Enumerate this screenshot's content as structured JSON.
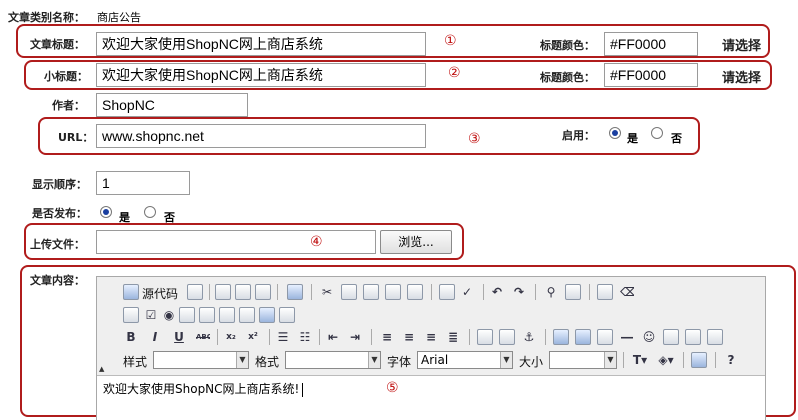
{
  "category": {
    "label": "文章类别名称：",
    "value": "商店公告"
  },
  "title_row": {
    "label": "文章标题：",
    "value": "欢迎大家使用ShopNC网上商店系统",
    "color_label": "标题颜色：",
    "color_value": "#FF0000",
    "pick_label": "请选择",
    "marker": "①"
  },
  "subtitle_row": {
    "label": "小标题：",
    "value": "欢迎大家使用ShopNC网上商店系统",
    "color_label": "标题颜色：",
    "color_value": "#FF0000",
    "pick_label": "请选择",
    "marker": "②"
  },
  "author": {
    "label": "作者：",
    "value": "ShopNC"
  },
  "url_row": {
    "label": "URL：",
    "value": "www.shopnc.net",
    "enable_label": "启用：",
    "yes": "是",
    "no": "否",
    "selected": "yes",
    "marker": "③"
  },
  "order": {
    "label": "显示顺序：",
    "value": "1"
  },
  "publish": {
    "label": "是否发布：",
    "yes": "是",
    "no": "否",
    "selected": "yes"
  },
  "upload": {
    "label": "上传文件：",
    "value": "",
    "browse_label": "浏览...",
    "marker": "④"
  },
  "content_row": {
    "label": "文章内容：",
    "marker": "⑤",
    "source_label": "源代码",
    "style_label": "样式",
    "format_label": "格式",
    "font_label": "字体",
    "font_value": "Arial",
    "size_label": "大小",
    "body_text": "欢迎大家使用ShopNC网上商店系统!",
    "bold": "B",
    "italic": "I",
    "underline": "U",
    "strike": "ABC",
    "sub": "x₂",
    "sup": "x²"
  },
  "colors": {
    "frame": "#b01c1c",
    "marker": "#c01010",
    "radio_dot": "#1a3fa0"
  }
}
